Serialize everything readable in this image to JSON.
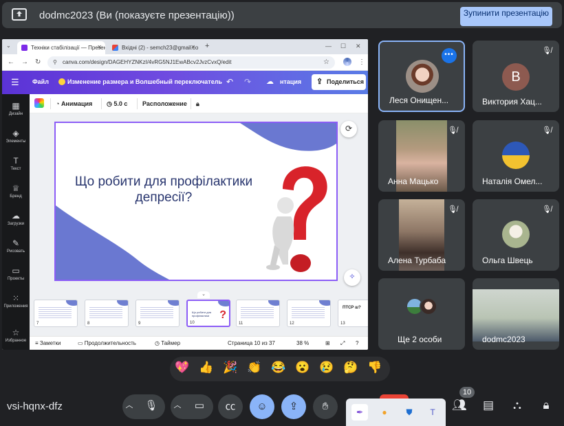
{
  "banner": {
    "title": "dodmc2023 (Ви (показуєте презентацію))",
    "stop_label": "Зупинити презентацію"
  },
  "browser": {
    "tabs": [
      {
        "label": "Техніки стабілізації — Презен...",
        "active": true
      },
      {
        "label": "Вхідні (2) - semch23@gmail.co...",
        "active": false
      }
    ],
    "url": "canva.com/design/DAGEHYZNKzI/4vRG5NJ1EwABcv2JvzCvxQ/edit"
  },
  "canva": {
    "menu_file": "Файл",
    "resize_label": "Изменение размера и Волшебный переключатель",
    "present_label": "нтация",
    "share_label": "Поделиться",
    "sidebar": [
      {
        "label": "Дизайн",
        "icon": "layout-icon"
      },
      {
        "label": "Элементы",
        "icon": "shapes-icon"
      },
      {
        "label": "Текст",
        "icon": "text-icon"
      },
      {
        "label": "Бренд",
        "icon": "brand-icon"
      },
      {
        "label": "Загрузки",
        "icon": "upload-icon"
      },
      {
        "label": "Рисовать",
        "icon": "draw-icon"
      },
      {
        "label": "Проекты",
        "icon": "folder-icon"
      },
      {
        "label": "Приложения",
        "icon": "apps-icon"
      },
      {
        "label": "Избранное",
        "icon": "star-icon"
      }
    ],
    "toolbar": {
      "animation": "Анимация",
      "duration": "5.0 с",
      "arrange": "Расположение"
    },
    "slide": {
      "title": "Що робити для профілактики депресії?"
    },
    "thumbnails": [
      "7",
      "8",
      "9",
      "10",
      "11",
      "12",
      "13"
    ],
    "thumb_13_text": "ПТСР ш?",
    "status": {
      "notes": "Заметки",
      "duration": "Продолжительность",
      "timer": "Таймер",
      "page": "Страница 10 из 37",
      "zoom": "38 %"
    }
  },
  "participants": [
    {
      "name": "Леся Онищен...",
      "kind": "avatar-photo",
      "active": true
    },
    {
      "name": "Виктория Хац...",
      "kind": "letter",
      "letter": "В"
    },
    {
      "name": "Анна Мацько",
      "kind": "video"
    },
    {
      "name": "Наталія Омел...",
      "kind": "avatar-photo"
    },
    {
      "name": "Алена Турбаба",
      "kind": "video"
    },
    {
      "name": "Ольга Швець",
      "kind": "avatar-photo"
    },
    {
      "name": "Ще 2 особи",
      "kind": "group"
    },
    {
      "name": "dodmc2023",
      "kind": "video"
    }
  ],
  "reactions": [
    "💖",
    "👍",
    "🎉",
    "👏",
    "😂",
    "😮",
    "😢",
    "🤔",
    "👎"
  ],
  "controls": {
    "meeting_code": "vsi-hqnx-dfz",
    "participants_count": "10"
  },
  "colors": {
    "meet_bg": "#202124",
    "tile_bg": "#3c4043",
    "accent_blue": "#8ab4f8",
    "canva_purple": "#5b33d6",
    "slide_title": "#28356e",
    "question_red": "#d8232a"
  }
}
